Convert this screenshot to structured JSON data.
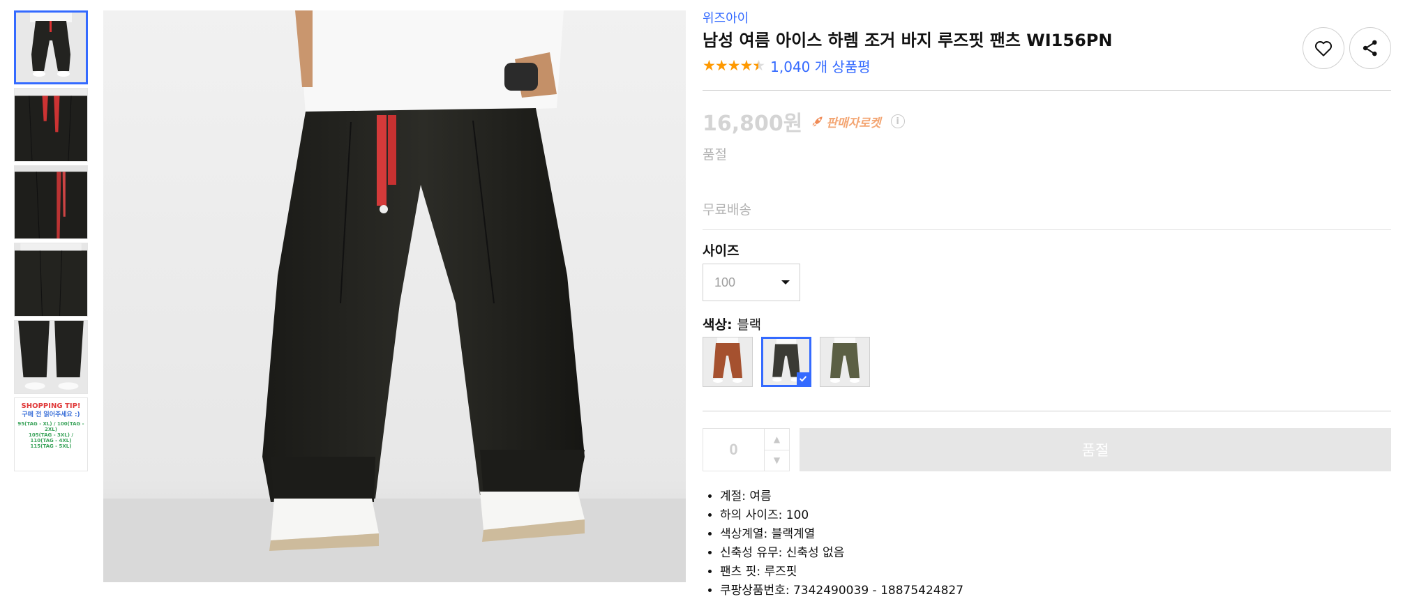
{
  "thumbnails": [
    {
      "alt": "pants front full"
    },
    {
      "alt": "waist drawstring detail"
    },
    {
      "alt": "waist side detail"
    },
    {
      "alt": "back detail"
    },
    {
      "alt": "pants hem detail"
    },
    {
      "alt": "shopping tip",
      "tip_title": "SHOPPING TIP!",
      "tip_sub": "구매 전 읽어주세요 :)",
      "tip_size_1": "95(TAG - XL) / 100(TAG - 2XL)",
      "tip_size_2": "105(TAG - 3XL) / 110(TAG - 4XL)",
      "tip_size_3": "115(TAG - 5XL)"
    }
  ],
  "product": {
    "brand": "위즈아이",
    "title": "남성 여름 아이스 하렘 조거 바지 루즈핏 팬츠 WI156PN",
    "rating": 4.5,
    "review_count": "1,040 개 상품평",
    "price": "16,800원",
    "rocket_label": "판매자로켓",
    "info_icon": "i",
    "soldout": "품절",
    "shipping": "무료배송"
  },
  "options": {
    "size_label": "사이즈",
    "size_value": "100",
    "color_label": "색상:",
    "color_value": "블랙",
    "swatches": [
      {
        "name": "브라운",
        "color": "#a5512f"
      },
      {
        "name": "블랙",
        "color": "#3a3a34",
        "selected": true
      },
      {
        "name": "카키",
        "color": "#5b5f44"
      }
    ]
  },
  "purchase": {
    "quantity": "0",
    "buy_label": "품절"
  },
  "attributes": [
    "계절: 여름",
    "하의 사이즈: 100",
    "색상계열: 블랙계열",
    "신축성 유무: 신축성 없음",
    "팬츠 핏: 루즈핏",
    "쿠팡상품번호: 7342490039 - 18875424827"
  ],
  "icons": {
    "heart": "heart-icon",
    "share": "share-icon",
    "rocket": "rocket-icon",
    "check": "check-icon"
  },
  "colors": {
    "accent": "#346aff",
    "star": "#ff9900",
    "rocket": "#f3a572",
    "disabled": "#e6e6e6"
  }
}
